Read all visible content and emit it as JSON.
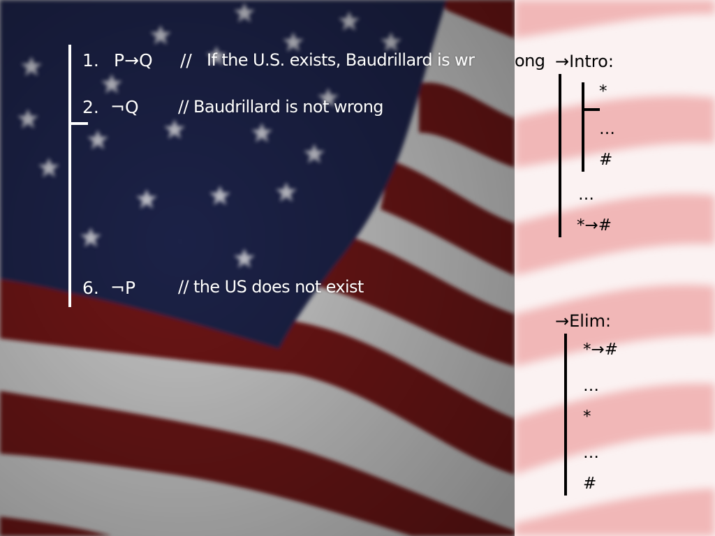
{
  "proof": {
    "line1": {
      "number": "1.",
      "formula": "P→Q",
      "comment_open": "//",
      "comment_a": "If the U.S. exists, Baudrillard is wr",
      "comment_b": "ong"
    },
    "line2": {
      "number": "2.",
      "formula": "¬Q",
      "comment": "// Baudrillard is not wrong"
    },
    "line6": {
      "number": "6.",
      "formula": "¬P",
      "comment": "// the US does not exist"
    }
  },
  "intro_rule": {
    "title": "→Intro:",
    "assume": "*",
    "dots_inner": "…",
    "derive": "#",
    "dots_outer": "…",
    "conclusion": "*→#"
  },
  "elim_rule": {
    "title": "→Elim:",
    "conditional": "*→#",
    "dots1": "…",
    "antecedent": "*",
    "dots2": "…",
    "result": "#"
  },
  "colors": {
    "canton_blue": "#1b2146",
    "stripe_red": "#6e1414",
    "stripe_white": "#cfcfcf",
    "panel_red": "#f1b7b7",
    "panel_white": "#fbf2f2"
  }
}
